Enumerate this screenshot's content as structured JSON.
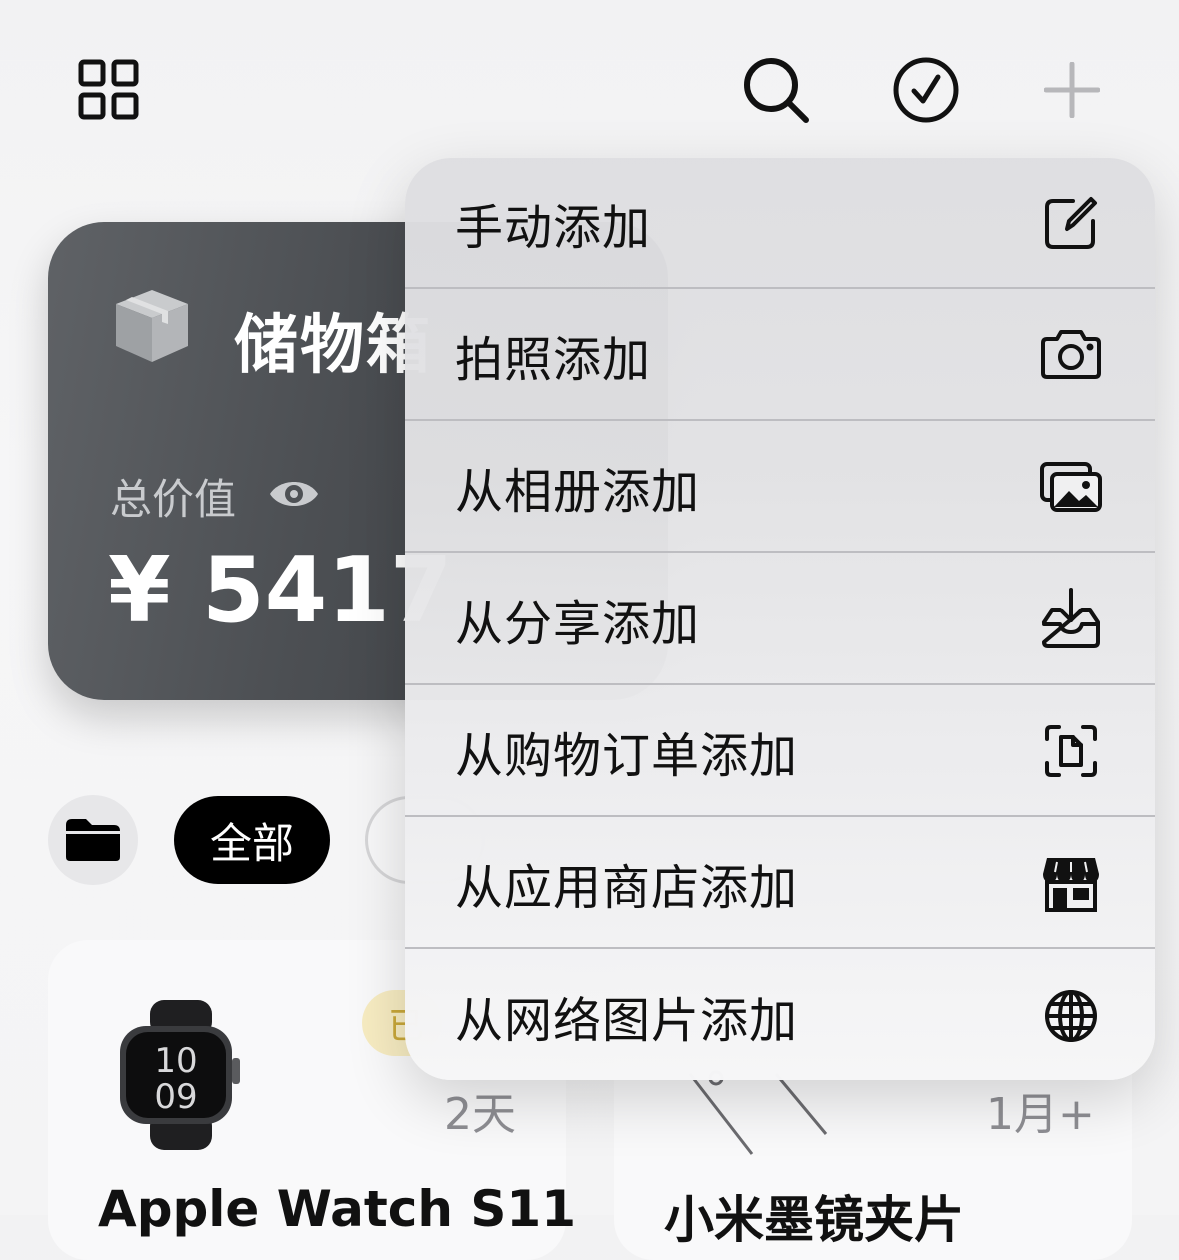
{
  "toolbar": {
    "grid_icon": "grid-icon",
    "search_icon": "search-icon",
    "select_icon": "checkmark-circle-icon",
    "add_icon": "plus-icon"
  },
  "storage_card": {
    "title": "储物箱",
    "total_label": "总价值",
    "total_value": "¥ 5417"
  },
  "filters": {
    "all_label": "全部"
  },
  "items": [
    {
      "name": "Apple Watch S11",
      "age": "2天",
      "badge": "已"
    },
    {
      "name": "小米墨镜夹片",
      "age": "1月+"
    }
  ],
  "menu": {
    "items": [
      {
        "label": "手动添加",
        "icon": "edit-icon"
      },
      {
        "label": "拍照添加",
        "icon": "camera-icon"
      },
      {
        "label": "从相册添加",
        "icon": "photos-icon"
      },
      {
        "label": "从分享添加",
        "icon": "tray-download-icon"
      },
      {
        "label": "从购物订单添加",
        "icon": "document-scan-icon"
      },
      {
        "label": "从应用商店添加",
        "icon": "storefront-icon"
      },
      {
        "label": "从网络图片添加",
        "icon": "globe-icon"
      }
    ]
  },
  "colors": {
    "card_bg": "#4c4f53",
    "accent_black": "#000000",
    "badge_bg": "#f7ecc2",
    "secondary_text": "#8e8e93"
  }
}
